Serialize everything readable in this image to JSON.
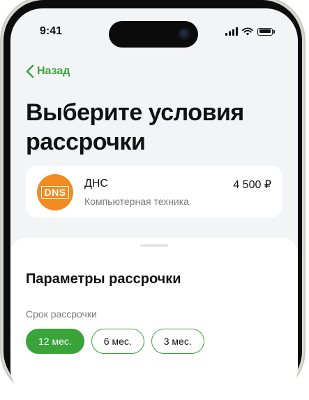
{
  "status_bar": {
    "time": "9:41"
  },
  "nav": {
    "back_label": "Назад"
  },
  "page": {
    "title": "Выберите условия рассрочки"
  },
  "merchant": {
    "logo_text": "DNS",
    "name": "ДНС",
    "category": "Компьютерная техника",
    "price": "4 500 ₽"
  },
  "installment": {
    "section_title": "Параметры рассрочки",
    "term_label": "Срок рассрочки",
    "terms": [
      {
        "label": "12 мес.",
        "selected": true
      },
      {
        "label": "6 мес.",
        "selected": false
      },
      {
        "label": "3 мес.",
        "selected": false
      }
    ]
  },
  "colors": {
    "accent": "#3aa43a",
    "logo_bg": "#f28b22",
    "screen_bg": "#f3f4f6"
  }
}
